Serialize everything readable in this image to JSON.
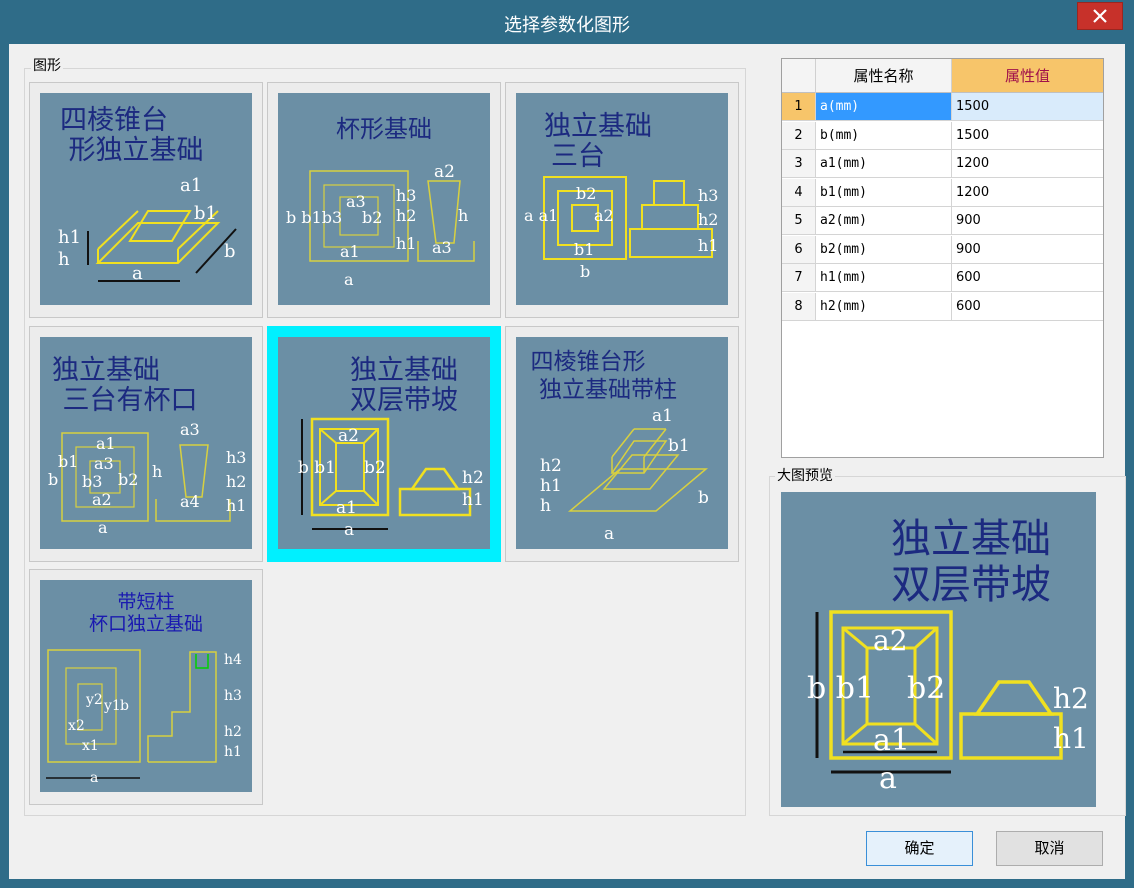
{
  "window": {
    "title": "选择参数化图形"
  },
  "shapes_group": {
    "label": "图形",
    "tiles": [
      {
        "id": "tile-1",
        "title_lines": [
          "四棱锥台",
          "形独立基础"
        ],
        "labels": [
          "a1",
          "b1",
          "h1",
          "h",
          "a",
          "b"
        ]
      },
      {
        "id": "tile-2",
        "title_lines": [
          "杯形基础"
        ],
        "labels": [
          "a2",
          "b b1b3",
          "a3",
          "b2",
          "h3",
          "h2",
          "h1",
          "h",
          "a1",
          "a3",
          "a"
        ]
      },
      {
        "id": "tile-3",
        "title_lines": [
          "独立基础",
          "三台"
        ],
        "labels": [
          "a a1",
          "b2",
          "a2",
          "h3",
          "h2",
          "h1",
          "b1",
          "b"
        ]
      },
      {
        "id": "tile-4",
        "title_lines": [
          "独立基础",
          "三台有杯口"
        ],
        "labels": [
          "a3",
          "a1",
          "b1",
          "a3",
          "b",
          "b3",
          "b2",
          "a2",
          "h",
          "h3",
          "h2",
          "h1",
          "a4",
          "a"
        ]
      },
      {
        "id": "tile-5",
        "title_lines": [
          "独立基础",
          "双层带坡"
        ],
        "labels": [
          "a2",
          "b b1",
          "b2",
          "h2",
          "h1",
          "a1",
          "a"
        ],
        "selected": true
      },
      {
        "id": "tile-6",
        "title_lines": [
          "四棱锥台形",
          "独立基础带柱"
        ],
        "labels": [
          "a1",
          "b1",
          "h2",
          "h1",
          "h",
          "b",
          "a"
        ]
      },
      {
        "id": "tile-7",
        "title_lines": [
          "带短柱",
          "杯口独立基础"
        ],
        "labels": [
          "x2",
          "y2",
          "x1",
          "y1",
          "b",
          "h4",
          "h3",
          "h2",
          "h1",
          "a"
        ]
      }
    ]
  },
  "property_table": {
    "headers": {
      "name": "属性名称",
      "value": "属性值"
    },
    "rows": [
      {
        "index": "1",
        "name": "a(mm)",
        "value": "1500"
      },
      {
        "index": "2",
        "name": "b(mm)",
        "value": "1500"
      },
      {
        "index": "3",
        "name": "a1(mm)",
        "value": "1200"
      },
      {
        "index": "4",
        "name": "b1(mm)",
        "value": "1200"
      },
      {
        "index": "5",
        "name": "a2(mm)",
        "value": "900"
      },
      {
        "index": "6",
        "name": "b2(mm)",
        "value": "900"
      },
      {
        "index": "7",
        "name": "h1(mm)",
        "value": "600"
      },
      {
        "index": "8",
        "name": "h2(mm)",
        "value": "600"
      }
    ]
  },
  "preview_group": {
    "label": "大图预览",
    "title_lines": [
      "独立基础",
      "双层带坡"
    ],
    "labels": [
      "a2",
      "b b1",
      "b2",
      "h2",
      "h1",
      "a1",
      "a"
    ]
  },
  "buttons": {
    "ok": "确定",
    "cancel": "取消"
  },
  "colors": {
    "title_bar": "#2f6c88",
    "close_button": "#c7312a",
    "thumb_bg": "#6b8fa5",
    "drawing_yellow": "#f0e020",
    "selection": "#00f0ff",
    "value_header": "#f7c56a"
  }
}
